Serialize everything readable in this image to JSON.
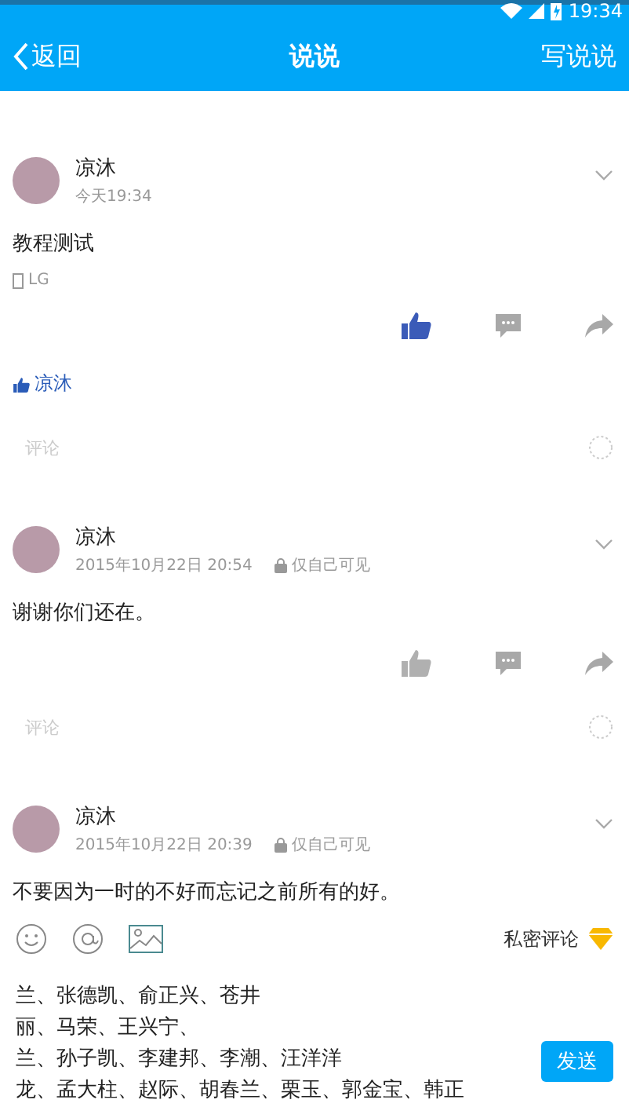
{
  "status_bar": {
    "time": "19:34"
  },
  "header": {
    "back": "返回",
    "title": "说说",
    "action": "写说说"
  },
  "posts": [
    {
      "name": "凉沐",
      "time": "今天19:34",
      "content": "教程测试",
      "device": "LG",
      "liked": true,
      "likers": [
        "凉沐"
      ],
      "comment_placeholder": "评论"
    },
    {
      "name": "凉沐",
      "time": "2015年10月22日 20:54",
      "visibility": "仅自己可见",
      "content": "谢谢你们还在。",
      "liked": false,
      "comment_placeholder": "评论"
    },
    {
      "name": "凉沐",
      "time": "2015年10月22日 20:39",
      "visibility": "仅自己可见",
      "content": "不要因为一时的不好而忘记之前所有的好。"
    }
  ],
  "comment_editor": {
    "private_label": "私密评论",
    "lines": [
      "兰、张德凯、俞正兴、苍井",
      "丽、马荣、王兴宁、",
      "兰、孙子凯、李建邦、李潮、汪洋洋",
      "龙、孟大柱、赵际、胡春兰、栗玉、郭金宝、韩正"
    ],
    "send": "发送"
  }
}
